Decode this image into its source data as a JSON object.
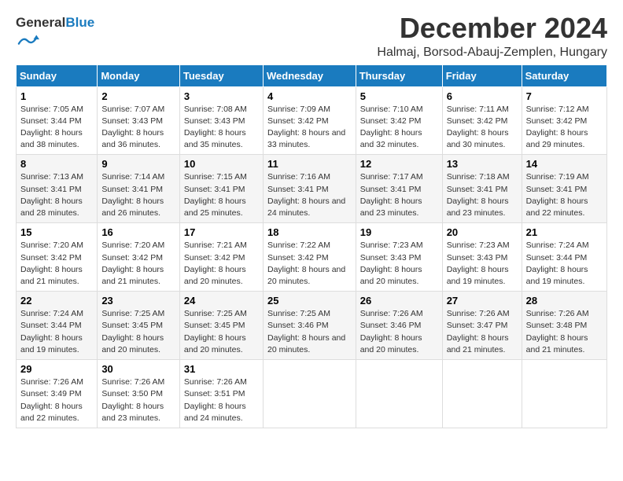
{
  "logo": {
    "text_general": "General",
    "text_blue": "Blue"
  },
  "title": "December 2024",
  "subtitle": "Halmaj, Borsod-Abauj-Zemplen, Hungary",
  "header": {
    "accent_color": "#1a7bbf"
  },
  "days_of_week": [
    "Sunday",
    "Monday",
    "Tuesday",
    "Wednesday",
    "Thursday",
    "Friday",
    "Saturday"
  ],
  "weeks": [
    [
      {
        "num": "1",
        "sunrise": "Sunrise: 7:05 AM",
        "sunset": "Sunset: 3:44 PM",
        "daylight": "Daylight: 8 hours and 38 minutes."
      },
      {
        "num": "2",
        "sunrise": "Sunrise: 7:07 AM",
        "sunset": "Sunset: 3:43 PM",
        "daylight": "Daylight: 8 hours and 36 minutes."
      },
      {
        "num": "3",
        "sunrise": "Sunrise: 7:08 AM",
        "sunset": "Sunset: 3:43 PM",
        "daylight": "Daylight: 8 hours and 35 minutes."
      },
      {
        "num": "4",
        "sunrise": "Sunrise: 7:09 AM",
        "sunset": "Sunset: 3:42 PM",
        "daylight": "Daylight: 8 hours and 33 minutes."
      },
      {
        "num": "5",
        "sunrise": "Sunrise: 7:10 AM",
        "sunset": "Sunset: 3:42 PM",
        "daylight": "Daylight: 8 hours and 32 minutes."
      },
      {
        "num": "6",
        "sunrise": "Sunrise: 7:11 AM",
        "sunset": "Sunset: 3:42 PM",
        "daylight": "Daylight: 8 hours and 30 minutes."
      },
      {
        "num": "7",
        "sunrise": "Sunrise: 7:12 AM",
        "sunset": "Sunset: 3:42 PM",
        "daylight": "Daylight: 8 hours and 29 minutes."
      }
    ],
    [
      {
        "num": "8",
        "sunrise": "Sunrise: 7:13 AM",
        "sunset": "Sunset: 3:41 PM",
        "daylight": "Daylight: 8 hours and 28 minutes."
      },
      {
        "num": "9",
        "sunrise": "Sunrise: 7:14 AM",
        "sunset": "Sunset: 3:41 PM",
        "daylight": "Daylight: 8 hours and 26 minutes."
      },
      {
        "num": "10",
        "sunrise": "Sunrise: 7:15 AM",
        "sunset": "Sunset: 3:41 PM",
        "daylight": "Daylight: 8 hours and 25 minutes."
      },
      {
        "num": "11",
        "sunrise": "Sunrise: 7:16 AM",
        "sunset": "Sunset: 3:41 PM",
        "daylight": "Daylight: 8 hours and 24 minutes."
      },
      {
        "num": "12",
        "sunrise": "Sunrise: 7:17 AM",
        "sunset": "Sunset: 3:41 PM",
        "daylight": "Daylight: 8 hours and 23 minutes."
      },
      {
        "num": "13",
        "sunrise": "Sunrise: 7:18 AM",
        "sunset": "Sunset: 3:41 PM",
        "daylight": "Daylight: 8 hours and 23 minutes."
      },
      {
        "num": "14",
        "sunrise": "Sunrise: 7:19 AM",
        "sunset": "Sunset: 3:41 PM",
        "daylight": "Daylight: 8 hours and 22 minutes."
      }
    ],
    [
      {
        "num": "15",
        "sunrise": "Sunrise: 7:20 AM",
        "sunset": "Sunset: 3:42 PM",
        "daylight": "Daylight: 8 hours and 21 minutes."
      },
      {
        "num": "16",
        "sunrise": "Sunrise: 7:20 AM",
        "sunset": "Sunset: 3:42 PM",
        "daylight": "Daylight: 8 hours and 21 minutes."
      },
      {
        "num": "17",
        "sunrise": "Sunrise: 7:21 AM",
        "sunset": "Sunset: 3:42 PM",
        "daylight": "Daylight: 8 hours and 20 minutes."
      },
      {
        "num": "18",
        "sunrise": "Sunrise: 7:22 AM",
        "sunset": "Sunset: 3:42 PM",
        "daylight": "Daylight: 8 hours and 20 minutes."
      },
      {
        "num": "19",
        "sunrise": "Sunrise: 7:23 AM",
        "sunset": "Sunset: 3:43 PM",
        "daylight": "Daylight: 8 hours and 20 minutes."
      },
      {
        "num": "20",
        "sunrise": "Sunrise: 7:23 AM",
        "sunset": "Sunset: 3:43 PM",
        "daylight": "Daylight: 8 hours and 19 minutes."
      },
      {
        "num": "21",
        "sunrise": "Sunrise: 7:24 AM",
        "sunset": "Sunset: 3:44 PM",
        "daylight": "Daylight: 8 hours and 19 minutes."
      }
    ],
    [
      {
        "num": "22",
        "sunrise": "Sunrise: 7:24 AM",
        "sunset": "Sunset: 3:44 PM",
        "daylight": "Daylight: 8 hours and 19 minutes."
      },
      {
        "num": "23",
        "sunrise": "Sunrise: 7:25 AM",
        "sunset": "Sunset: 3:45 PM",
        "daylight": "Daylight: 8 hours and 20 minutes."
      },
      {
        "num": "24",
        "sunrise": "Sunrise: 7:25 AM",
        "sunset": "Sunset: 3:45 PM",
        "daylight": "Daylight: 8 hours and 20 minutes."
      },
      {
        "num": "25",
        "sunrise": "Sunrise: 7:25 AM",
        "sunset": "Sunset: 3:46 PM",
        "daylight": "Daylight: 8 hours and 20 minutes."
      },
      {
        "num": "26",
        "sunrise": "Sunrise: 7:26 AM",
        "sunset": "Sunset: 3:46 PM",
        "daylight": "Daylight: 8 hours and 20 minutes."
      },
      {
        "num": "27",
        "sunrise": "Sunrise: 7:26 AM",
        "sunset": "Sunset: 3:47 PM",
        "daylight": "Daylight: 8 hours and 21 minutes."
      },
      {
        "num": "28",
        "sunrise": "Sunrise: 7:26 AM",
        "sunset": "Sunset: 3:48 PM",
        "daylight": "Daylight: 8 hours and 21 minutes."
      }
    ],
    [
      {
        "num": "29",
        "sunrise": "Sunrise: 7:26 AM",
        "sunset": "Sunset: 3:49 PM",
        "daylight": "Daylight: 8 hours and 22 minutes."
      },
      {
        "num": "30",
        "sunrise": "Sunrise: 7:26 AM",
        "sunset": "Sunset: 3:50 PM",
        "daylight": "Daylight: 8 hours and 23 minutes."
      },
      {
        "num": "31",
        "sunrise": "Sunrise: 7:26 AM",
        "sunset": "Sunset: 3:51 PM",
        "daylight": "Daylight: 8 hours and 24 minutes."
      },
      null,
      null,
      null,
      null
    ]
  ]
}
